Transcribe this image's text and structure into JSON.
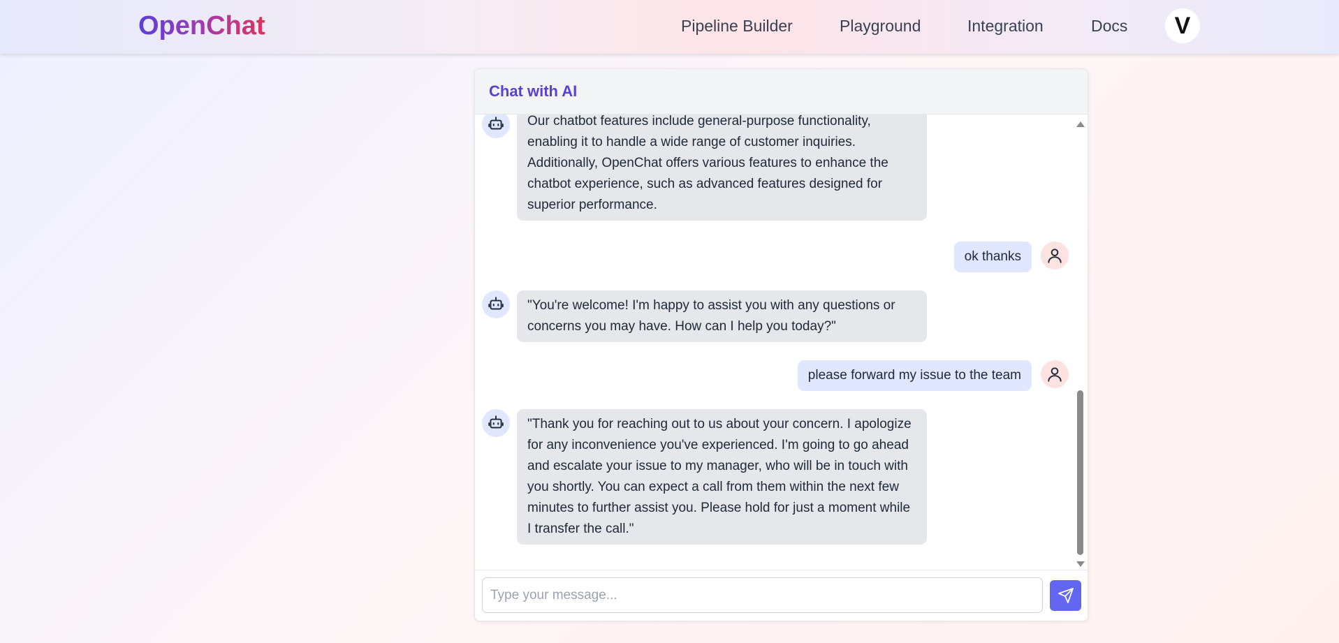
{
  "header": {
    "logo": "OpenChat",
    "nav": [
      {
        "label": "Pipeline Builder"
      },
      {
        "label": "Playground"
      },
      {
        "label": "Integration"
      },
      {
        "label": "Docs"
      }
    ],
    "avatar_letter": "V"
  },
  "chat": {
    "title": "Chat with AI",
    "messages": [
      {
        "role": "bot",
        "icon": "robot-icon",
        "text": "Our chatbot features include general-purpose functionality, enabling it to handle a wide range of customer inquiries. Additionally, OpenChat offers various features to enhance the chatbot experience, such as advanced features designed for superior performance."
      },
      {
        "role": "user",
        "icon": "user-icon",
        "text": "ok thanks"
      },
      {
        "role": "bot",
        "icon": "robot-icon",
        "text": "\"You're welcome! I'm happy to assist you with any questions or concerns you may have. How can I help you today?\""
      },
      {
        "role": "user",
        "icon": "user-icon",
        "text": "please forward my issue to the team"
      },
      {
        "role": "bot",
        "icon": "robot-icon",
        "text": "\"Thank you for reaching out to us about your concern. I apologize for any inconvenience you've experienced. I'm going to go ahead and escalate your issue to my manager, who will be in touch with you shortly. You can expect a call from them within the next few minutes to further assist you. Please hold for just a moment while I transfer the call.\""
      }
    ],
    "input": {
      "placeholder": "Type your message...",
      "value": ""
    },
    "send_icon": "send-icon"
  },
  "colors": {
    "brand_purple": "#5b3fd6",
    "brand_pink": "#e0335a",
    "send_button": "#6366f1",
    "bot_bubble": "#e5e7eb",
    "user_bubble": "#e0e7ff"
  }
}
